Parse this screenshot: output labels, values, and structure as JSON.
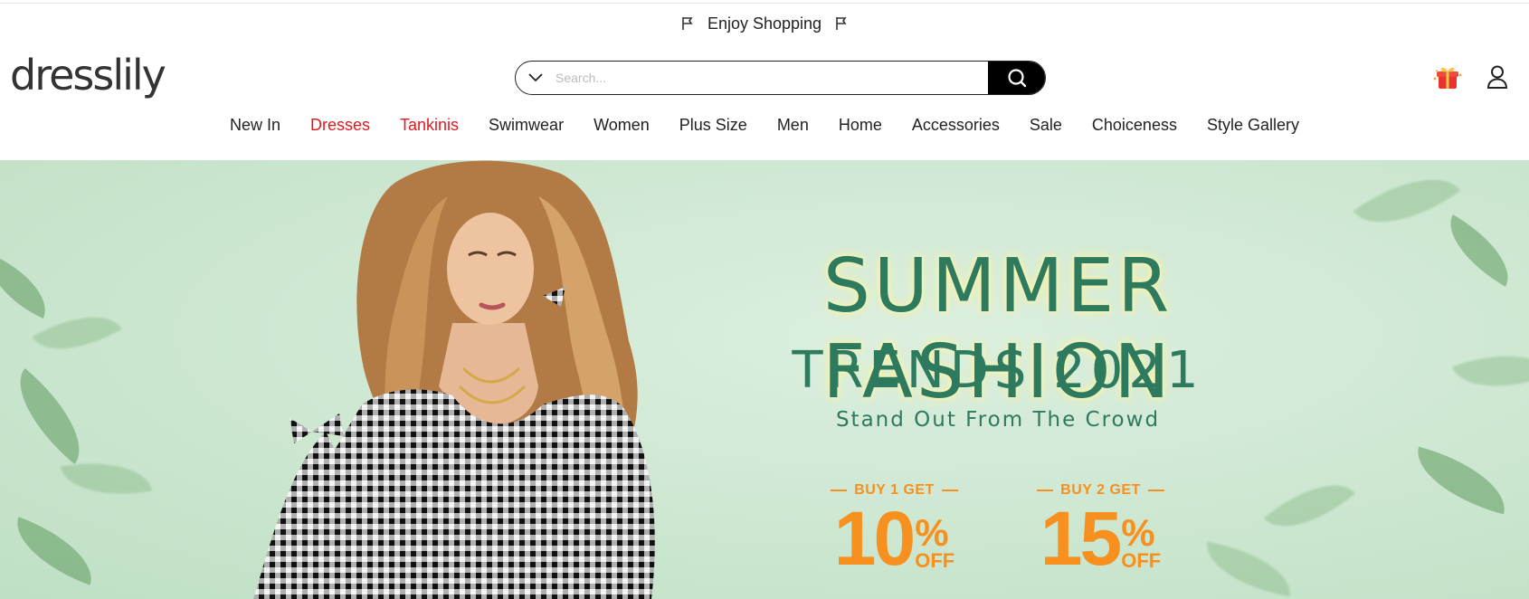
{
  "announcement": {
    "text": "Enjoy Shopping",
    "icon": "flag-icon"
  },
  "brand": {
    "logo_text": "dresslily"
  },
  "search": {
    "placeholder": "Search..."
  },
  "header_icons": {
    "gift": "gift-icon",
    "account": "user-icon"
  },
  "nav": {
    "items": [
      {
        "label": "New In",
        "highlight": false
      },
      {
        "label": "Dresses",
        "highlight": true
      },
      {
        "label": "Tankinis",
        "highlight": true
      },
      {
        "label": "Swimwear",
        "highlight": false
      },
      {
        "label": "Women",
        "highlight": false
      },
      {
        "label": "Plus Size",
        "highlight": false
      },
      {
        "label": "Men",
        "highlight": false
      },
      {
        "label": "Home",
        "highlight": false
      },
      {
        "label": "Accessories",
        "highlight": false
      },
      {
        "label": "Sale",
        "highlight": false
      },
      {
        "label": "Choiceness",
        "highlight": false
      },
      {
        "label": "Style Gallery",
        "highlight": false
      }
    ]
  },
  "banner": {
    "headline": "SUMMER FASHION",
    "subheadline": "TRENDS 2021",
    "tagline": "Stand Out From The Crowd",
    "offers": [
      {
        "label": "BUY 1 GET",
        "value": "10",
        "pct": "%",
        "suffix": "OFF"
      },
      {
        "label": "BUY 2 GET",
        "value": "15",
        "pct": "%",
        "suffix": "OFF"
      }
    ]
  },
  "colors": {
    "highlight_nav": "#e0191f",
    "headline": "#2d7a5e",
    "offer": "#f7901e",
    "banner_bg": "#cfe8d3"
  }
}
